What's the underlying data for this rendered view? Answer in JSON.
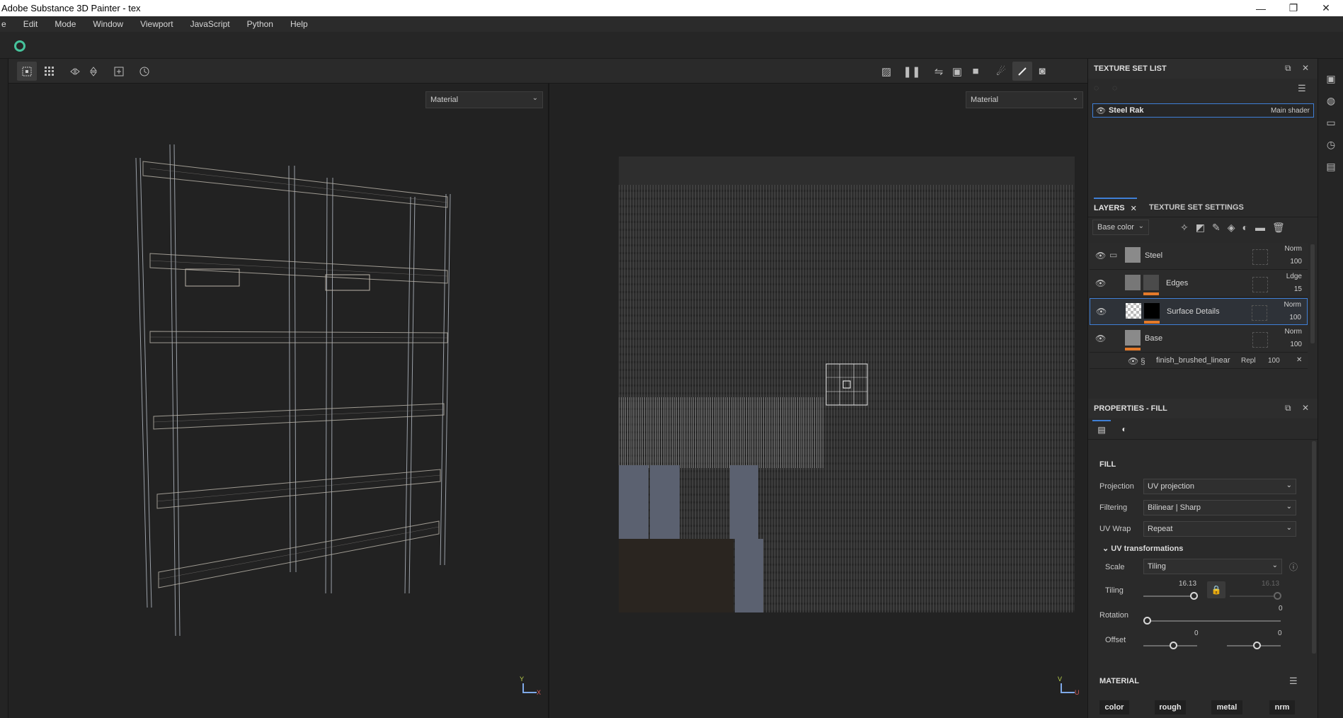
{
  "window": {
    "title": "Adobe Substance 3D Painter - tex",
    "minimize": "—",
    "maximize": "❐",
    "close": "✕"
  },
  "menu": [
    "e",
    "Edit",
    "Mode",
    "Window",
    "Viewport",
    "JavaScript",
    "Python",
    "Help"
  ],
  "viewports": {
    "left": {
      "mode": "Material",
      "axis_y": "Y",
      "axis_x": "X"
    },
    "right": {
      "mode": "Material",
      "axis_v": "V",
      "axis_u": "U"
    }
  },
  "texture_set_list": {
    "title": "TEXTURE SET LIST",
    "item_name": "Steel Rak",
    "item_shader": "Main shader"
  },
  "layers": {
    "tab_label": "LAYERS",
    "tab2_label": "TEXTURE SET SETTINGS",
    "channel": "Base color",
    "rows": [
      {
        "name": "Steel",
        "blend": "Norm",
        "opacity": "100"
      },
      {
        "name": "Edges",
        "blend": "Ldge",
        "opacity": "15"
      },
      {
        "name": "Surface Details",
        "blend": "Norm",
        "opacity": "100"
      },
      {
        "name": "Base",
        "blend": "Norm",
        "opacity": "100"
      }
    ],
    "effect": {
      "name": "finish_brushed_linear",
      "blend": "Repl",
      "opacity": "100"
    }
  },
  "properties": {
    "title": "PROPERTIES - FILL",
    "section": "FILL",
    "projection_label": "Projection",
    "projection_value": "UV projection",
    "filtering_label": "Filtering",
    "filtering_value": "Bilinear | Sharp",
    "uvwrap_label": "UV Wrap",
    "uvwrap_value": "Repeat",
    "uvtransform_label": "UV transformations",
    "scale_label": "Scale",
    "scale_value": "Tiling",
    "tiling_label": "Tiling",
    "tiling_value": "16.13",
    "tiling_value2": "16.13",
    "rotation_label": "Rotation",
    "rotation_value": "0",
    "offset_label": "Offset",
    "offset_value1": "0",
    "offset_value2": "0",
    "material_section": "MATERIAL",
    "material_buttons": [
      "color",
      "rough",
      "metal",
      "nrm"
    ]
  }
}
